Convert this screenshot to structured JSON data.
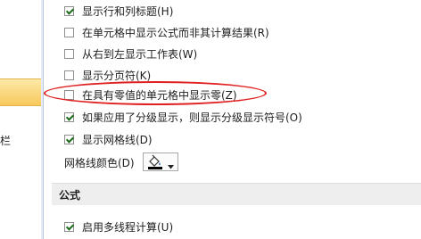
{
  "sidebar": {
    "truncated_label": "栏"
  },
  "options": [
    {
      "label": "显示行和列标题(H)",
      "checked": true
    },
    {
      "label": "在单元格中显示公式而非其计算结果(R)",
      "checked": false
    },
    {
      "label": "从右到左显示工作表(W)",
      "checked": false
    },
    {
      "label": "显示分页符(K)",
      "checked": false
    },
    {
      "label": "在具有零值的单元格中显示零(Z)",
      "checked": false
    },
    {
      "label": "如果应用了分级显示，则显示分级显示符号(O)",
      "checked": true
    },
    {
      "label": "显示网格线(D)",
      "checked": true
    }
  ],
  "gridline_color": {
    "label": "网格线颜色(D)",
    "icon": "paint-bucket-icon",
    "dropdown_icon": "caret-down-icon",
    "swatch_color": "#000000"
  },
  "formulas_section": {
    "title": "公式",
    "options": [
      {
        "label": "启用多线程计算(U)",
        "checked": true
      }
    ]
  },
  "colors": {
    "highlight_oval": "#e02020",
    "selected_sidebar": "#f7c95c"
  }
}
